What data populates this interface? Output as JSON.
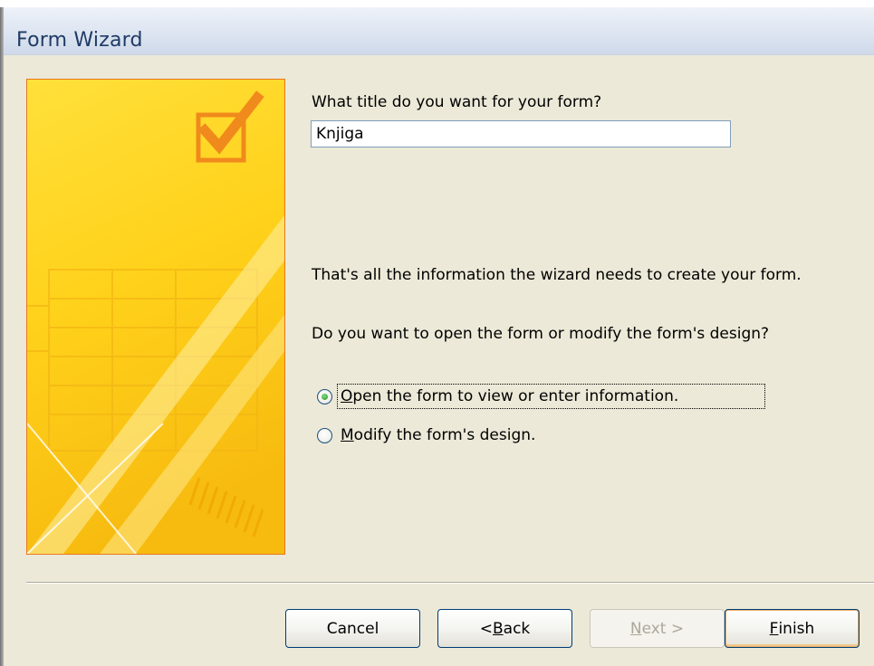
{
  "window": {
    "title": "Form Wizard"
  },
  "form": {
    "question": "What title do you want for your form?",
    "title_value": "Knjiga",
    "info": "That's all the information the wizard needs to create your form.",
    "open_question": "Do you want to open the form or modify the form's design?"
  },
  "options": [
    {
      "mnemonic": "O",
      "rest": "pen the form to view or enter information.",
      "selected": true
    },
    {
      "mnemonic": "M",
      "rest": "odify the form's design.",
      "selected": false
    }
  ],
  "buttons": {
    "cancel": "Cancel",
    "back_prefix": "< ",
    "back_mnemonic": "B",
    "back_rest": "ack",
    "next_mnemonic": "N",
    "next_rest": "ext >",
    "next_enabled": false,
    "finish_mnemonic": "F",
    "finish_rest": "inish"
  },
  "colors": {
    "panel_border": "#e8781c",
    "panel_yellow": "#ffd21f",
    "window_bg": "#ece9d8"
  }
}
